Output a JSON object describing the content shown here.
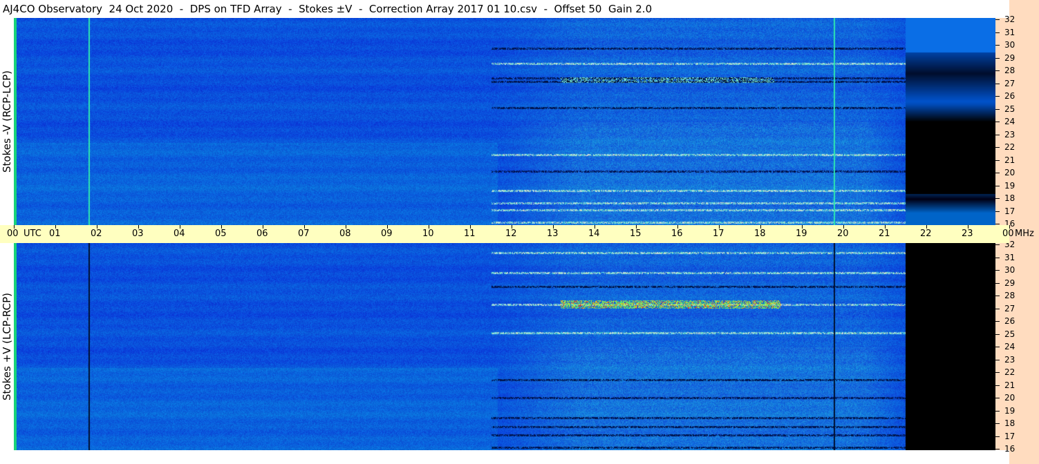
{
  "title": "AJ4CO Observatory  24 Oct 2020  -  DPS on TFD Array  -  Stokes ±V  -  Correction Array 2017 01 10.csv  -  Offset 50  Gain 2.0",
  "panels": {
    "top_label": "Stokes -V (RCP-LCP)",
    "bottom_label": "Stokes +V (LCP-RCP)"
  },
  "time_axis": {
    "labels": [
      "00",
      "UTC",
      "01",
      "02",
      "03",
      "04",
      "05",
      "06",
      "07",
      "08",
      "09",
      "10",
      "11",
      "12",
      "13",
      "14",
      "15",
      "16",
      "17",
      "18",
      "19",
      "20",
      "21",
      "22",
      "23",
      "00",
      "MHz"
    ]
  },
  "freq_axis": {
    "labels": [
      "32",
      "31",
      "30",
      "29",
      "28",
      "27",
      "26",
      "25",
      "24",
      "23",
      "22",
      "21",
      "20",
      "19",
      "18",
      "17",
      "16"
    ]
  },
  "colors": {
    "background_blue": "#0a6ee8",
    "axis_band": "#ffffc0",
    "freq_strip": "#ffdcbf"
  }
}
